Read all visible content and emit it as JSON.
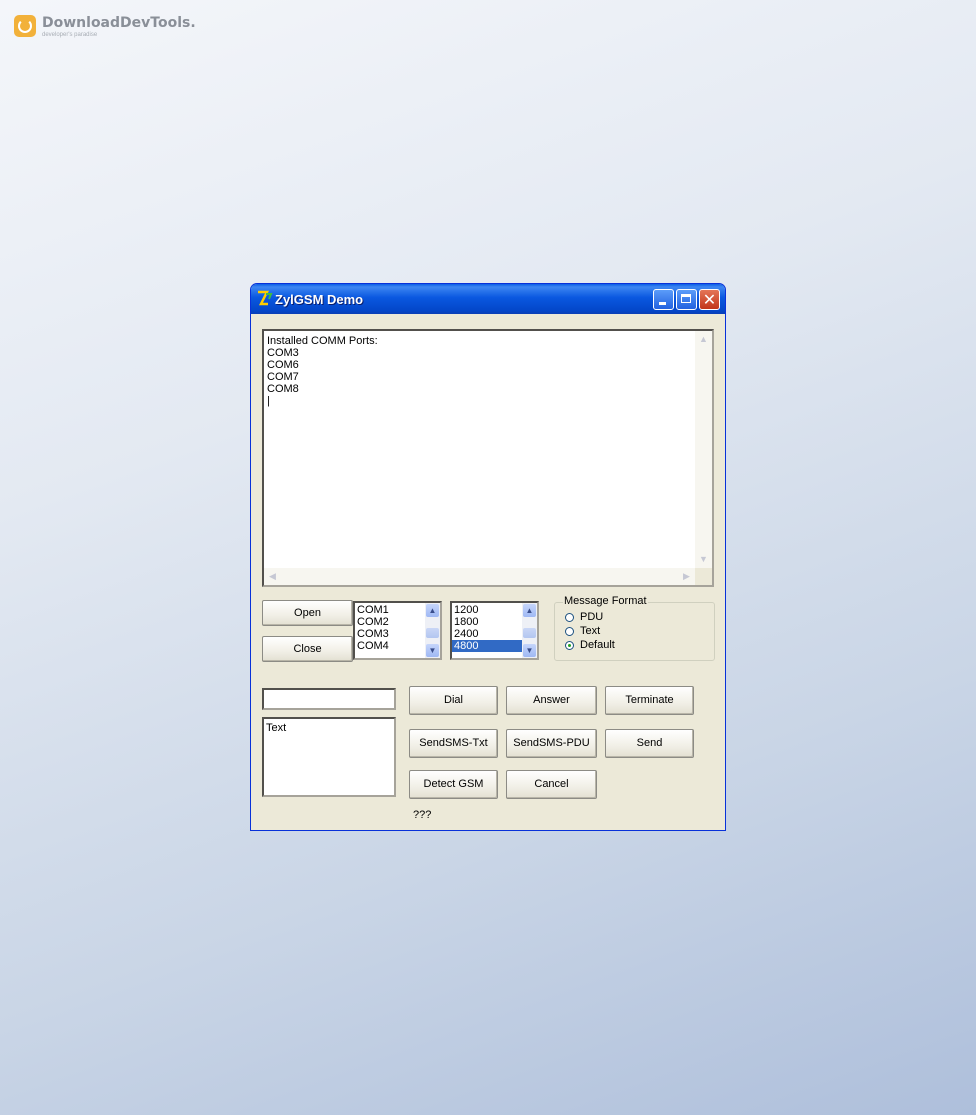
{
  "watermark": {
    "brand": "DownloadDevTools.",
    "tagline": "developer's paradise"
  },
  "window": {
    "title": "ZylGSM Demo",
    "icon": "zylgsm-app-icon",
    "controls": {
      "minimize": "minimize-icon",
      "maximize": "maximize-icon",
      "close": "✕"
    }
  },
  "log": {
    "lines": "Installed COMM Ports:\nCOM3\nCOM6\nCOM7\nCOM8\n|"
  },
  "ports": {
    "open_label": "Open",
    "close_label": "Close",
    "items": [
      "COM1",
      "COM2",
      "COM3",
      "COM4"
    ]
  },
  "baud_rates": {
    "items": [
      "1200",
      "1800",
      "2400",
      "4800"
    ],
    "selected": "4800"
  },
  "message_format": {
    "title": "Message Format",
    "options": [
      "PDU",
      "Text",
      "Default"
    ],
    "selected": "Default"
  },
  "phone_number": {
    "value": ""
  },
  "message_text": {
    "value": "Text"
  },
  "actions": {
    "dial": "Dial",
    "answer": "Answer",
    "terminate": "Terminate",
    "send_sms_txt": "SendSMS-Txt",
    "send_sms_pdu": "SendSMS-PDU",
    "send": "Send",
    "detect_gsm": "Detect GSM",
    "cancel": "Cancel"
  },
  "status_text": "???",
  "colors": {
    "titlebar": "#0a58e0",
    "selection": "#316ac5",
    "face": "#ece9d8"
  }
}
